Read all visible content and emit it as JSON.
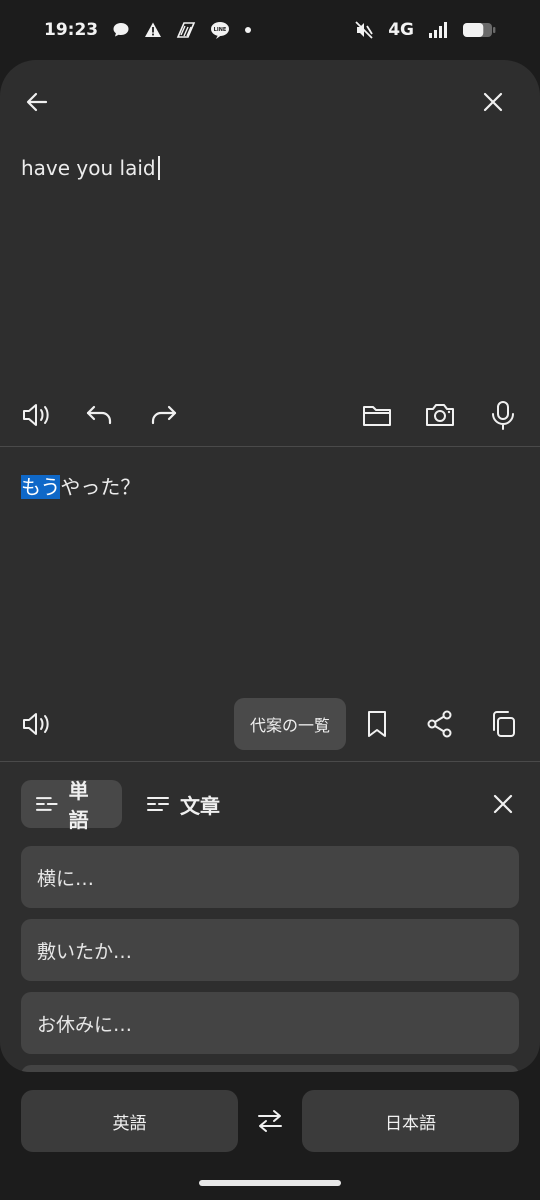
{
  "status": {
    "time": "19:23",
    "network": "4G",
    "left_icons": [
      "chat-bubble-icon",
      "warning-icon",
      "data-saver-icon",
      "line-app-icon",
      "notification-dot-icon"
    ],
    "right_icons": [
      "mute-icon",
      "signal-icon",
      "battery-icon"
    ],
    "battery_level": 0.7
  },
  "source": {
    "text": "have you laid"
  },
  "translation": {
    "highlighted": "もう",
    "rest": "やった？"
  },
  "alt_chip": {
    "label": "代案の一覧"
  },
  "suggestions_panel": {
    "tabs": [
      {
        "label": "単語",
        "active": true
      },
      {
        "label": "文章",
        "active": false
      }
    ],
    "items": [
      "横に…",
      "敷いたか…",
      "お休みに…"
    ]
  },
  "languages": {
    "source": "英語",
    "target": "日本語"
  },
  "colors": {
    "sheet_bg": "#2e2e2e",
    "page_bg": "#1c1c1c",
    "highlight": "#0f68c8",
    "card_bg": "#444444"
  }
}
